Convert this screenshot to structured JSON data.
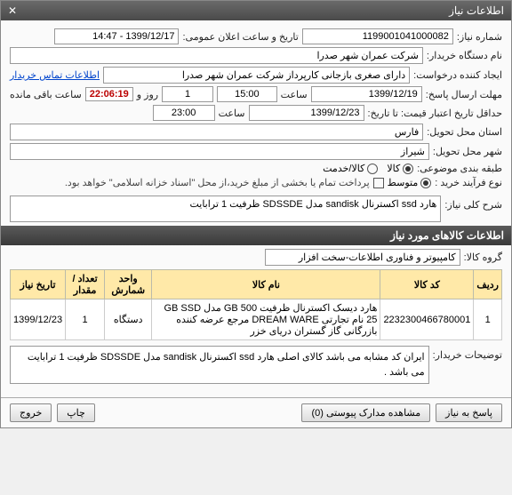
{
  "window": {
    "title": "اطلاعات نیاز",
    "close": "✕"
  },
  "labels": {
    "need_no": "شماره نیاز:",
    "announce": "تاریخ و ساعت اعلان عمومی:",
    "org": "نام دستگاه خریدار:",
    "creator": "ایجاد کننده درخواست:",
    "contact": "اطلاعات تماس خریدار",
    "deadline_ans": "مهلت ارسال پاسخ:",
    "until": "تا تاریخ:",
    "saat": "ساعت",
    "rooz": "روز و",
    "remain": "ساعت باقی مانده",
    "valid": "حداقل تاریخ اعتبار قیمت: تا تاریخ:",
    "province": "استان محل تحویل:",
    "city": "شهر محل تحویل:",
    "budget": "طبقه بندی موضوعی:",
    "kala": "کالا",
    "khadamat": "کالا/خدمت",
    "buytype": "نوع فرآیند خرید :",
    "mid": "متوسط",
    "paynote": "پرداخت تمام یا بخشی از مبلغ خرید،از محل \"اسناد خزانه اسلامی\" خواهد بود.",
    "general_desc": "شرح کلی نیاز:",
    "items_header": "اطلاعات کالاهای مورد نیاز",
    "group": "گروه کالا:",
    "buyer_desc": "توضیحات خریدار:"
  },
  "fields": {
    "need_no": "1199001041000082",
    "announce": "1399/12/17 - 14:47",
    "org": "شرکت عمران شهر صدرا",
    "creator": "دارای  صغری بازجانی کارپرداز شرکت عمران شهر صدرا",
    "deadline_date": "1399/12/19",
    "deadline_time": "15:00",
    "days_left": "1",
    "countdown": "22:06:19",
    "valid_date": "1399/12/23",
    "valid_time": "23:00",
    "province": "فارس",
    "city": "شیراز",
    "general_desc": "هارد ssd اکسترنال sandisk مدل SDSSDE ظرفیت 1 ترابایت",
    "group": "کامپیوتر و فناوری اطلاعات-سخت افزار",
    "buyer_desc": "ایران کد مشابه می باشد کالای اصلی هارد ssd اکسترنال sandisk مدل SDSSDE ظرفیت 1 ترابایت  می باشد ."
  },
  "table": {
    "headers": {
      "row": "ردیف",
      "code": "کد کالا",
      "name": "نام کالا",
      "unit": "واحد شمارش",
      "qty": "تعداد / مقدار",
      "date": "تاریخ نیاز"
    },
    "rows": [
      {
        "row": "1",
        "code": "2232300466780001",
        "name": "هارد دیسک اکسترنال ظرفیت GB 500 مدل GB SSD 25 نام تجارتی DREAM WARE مرجع عرضه کننده بازرگانی گاز گستران دریای خزر",
        "unit": "دستگاه",
        "qty": "1",
        "date": "1399/12/23"
      }
    ]
  },
  "footer": {
    "reply": "پاسخ به نیاز",
    "attach": "مشاهده مدارک پیوستی  (0)",
    "print": "چاپ",
    "exit": "خروج"
  }
}
